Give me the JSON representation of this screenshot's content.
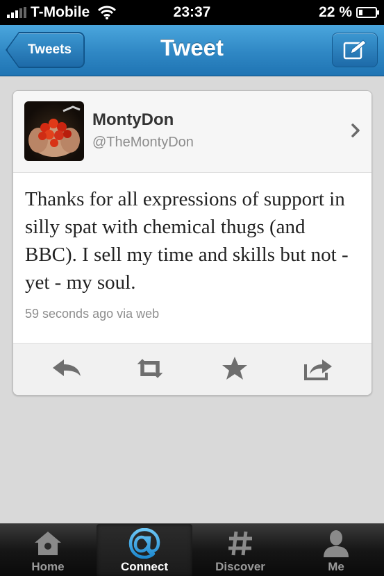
{
  "status_bar": {
    "carrier": "T-Mobile",
    "time": "23:37",
    "battery": "22 %",
    "battery_level": 0.22
  },
  "nav": {
    "back_label": "Tweets",
    "title": "Tweet",
    "compose_icon": "compose-icon"
  },
  "tweet": {
    "display_name": "MontyDon",
    "username": "@TheMontyDon",
    "text": "Thanks for all expressions of support in silly spat with chemical thugs (and BBC). I sell my time and skills but not - yet - my soul.",
    "meta": "59 seconds ago via web"
  },
  "actions": [
    "reply-icon",
    "retweet-icon",
    "favorite-icon",
    "share-icon"
  ],
  "tabs": [
    {
      "label": "Home",
      "icon": "home-icon",
      "selected": false
    },
    {
      "label": "Connect",
      "icon": "at-icon",
      "selected": true
    },
    {
      "label": "Discover",
      "icon": "hash-icon",
      "selected": false
    },
    {
      "label": "Me",
      "icon": "person-icon",
      "selected": false
    }
  ],
  "colors": {
    "nav_blue": "#2f87c4",
    "selected_tab_icon": "#3aa3e3"
  }
}
